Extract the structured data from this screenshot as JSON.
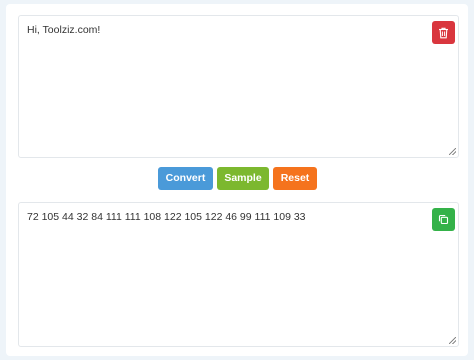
{
  "input": {
    "value": "Hi, Toolziz.com!"
  },
  "output": {
    "value": "72 105 44 32 84 111 111 108 122 105 122 46 99 111 109 33"
  },
  "actions": {
    "convert_label": "Convert",
    "sample_label": "Sample",
    "reset_label": "Reset"
  },
  "colors": {
    "convert": "#4a9ad9",
    "sample": "#7cb82f",
    "reset": "#f5731d",
    "delete": "#d9363e",
    "copy": "#34b249"
  },
  "icons": {
    "delete": "trash-icon",
    "copy": "copy-icon"
  }
}
